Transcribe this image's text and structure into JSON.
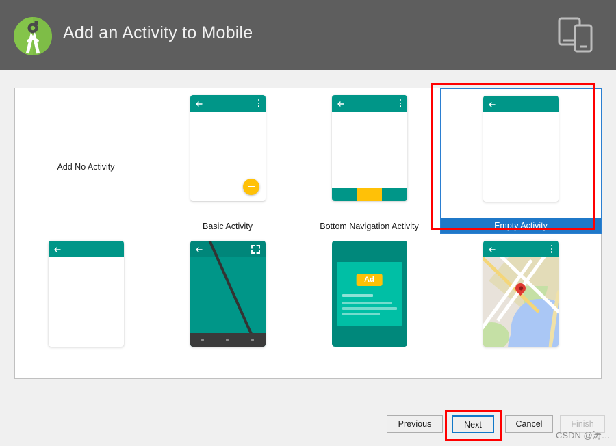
{
  "header": {
    "title": "Add an Activity to Mobile",
    "logo_icon": "android-studio-logo-icon",
    "device_icon": "tablet-and-phone-icon"
  },
  "gallery": {
    "items": [
      {
        "label": "Add No Activity",
        "type": "text-only",
        "selected": false
      },
      {
        "label": "Basic Activity",
        "type": "basic",
        "selected": false,
        "has_fab": true,
        "has_overflow": true
      },
      {
        "label": "Bottom Navigation Activity",
        "type": "bottom-navigation",
        "selected": false,
        "has_overflow": true,
        "nav_colors": [
          "#009688",
          "#FFC107",
          "#009688"
        ]
      },
      {
        "label": "Empty Activity",
        "type": "empty",
        "selected": true,
        "has_overflow": false
      },
      {
        "label": "",
        "type": "basic-plain",
        "selected": false,
        "has_overflow": false
      },
      {
        "label": "",
        "type": "fullscreen",
        "selected": false,
        "expand_icon": "fullscreen-expand-icon"
      },
      {
        "label": "",
        "type": "ad",
        "selected": false,
        "badge": "Ad"
      },
      {
        "label": "",
        "type": "maps",
        "selected": false,
        "has_overflow": true,
        "pin_icon": "map-pin-icon"
      }
    ]
  },
  "footer": {
    "previous": "Previous",
    "next": "Next",
    "cancel": "Cancel",
    "finish": "Finish"
  },
  "watermark": "CSDN @涛…",
  "colors": {
    "header_bg": "#5e5e5e",
    "teal": "#009688",
    "amber": "#FFC107",
    "selection_blue": "#1f78c8",
    "focus_blue": "#1278c8",
    "annotation_red": "#ff0000",
    "logo_green": "#78c257"
  }
}
